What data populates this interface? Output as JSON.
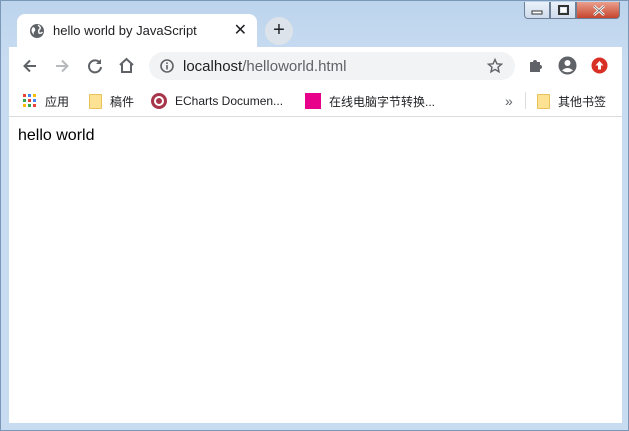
{
  "tab": {
    "title": "hello world by JavaScript",
    "close_glyph": "✕",
    "icon": "globe-icon"
  },
  "newtab": {
    "glyph": "+"
  },
  "toolbar": {
    "url_host": "localhost",
    "url_path": "/helloworld.html",
    "icons": [
      "back-icon",
      "forward-icon",
      "reload-icon",
      "home-icon",
      "info-icon",
      "star-icon",
      "extensions-icon",
      "profile-icon",
      "update-icon"
    ]
  },
  "bookmarks": {
    "apps": "应用",
    "item1": "稿件",
    "item2": "ECharts Documen...",
    "item3": "在线电脑字节转换...",
    "overflow": "»",
    "other": "其他书签"
  },
  "page": {
    "text": "hello world"
  },
  "colors": {
    "frame": "#c8dcf1",
    "tab_bg": "#ffffff",
    "omnibox_bg": "#f1f3f4",
    "update_red": "#d93025",
    "echarts_red": "#a8364b",
    "bookmark_pink": "#e8008a"
  }
}
